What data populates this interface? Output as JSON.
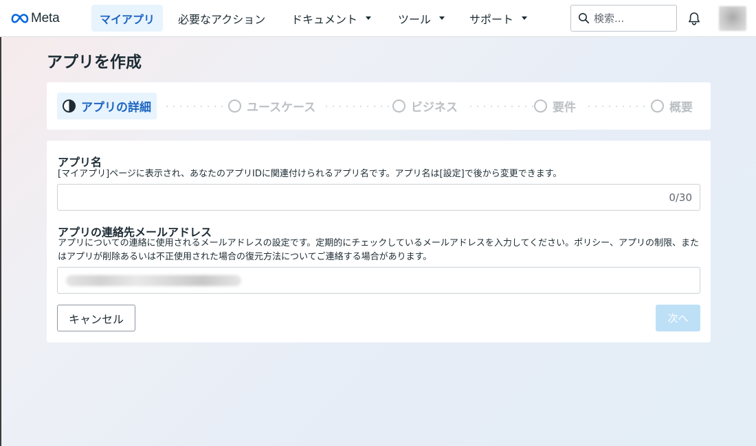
{
  "nav": {
    "logo_text": "Meta",
    "items": [
      {
        "label": "マイアプリ",
        "active": true
      },
      {
        "label": "必要なアクション"
      },
      {
        "label": "ドキュメント"
      },
      {
        "label": "ツール"
      },
      {
        "label": "サポート"
      }
    ],
    "search_placeholder": "検索...",
    "icons": {
      "search": "search-icon",
      "bell": "bell-icon",
      "dropdown": "caret-down-icon"
    }
  },
  "page": {
    "title": "アプリを作成"
  },
  "stepper": {
    "steps": [
      {
        "label": "アプリの詳細",
        "state": "current"
      },
      {
        "label": "ユースケース",
        "state": "todo"
      },
      {
        "label": "ビジネス",
        "state": "todo"
      },
      {
        "label": "要件",
        "state": "todo"
      },
      {
        "label": "概要",
        "state": "todo"
      }
    ]
  },
  "form": {
    "app_name": {
      "label": "アプリ名",
      "description": "[マイアプリ]ページに表示され、あなたのアプリIDに関連付けられるアプリ名です。アプリ名は[設定]で後から変更できます。",
      "value": "",
      "counter": "0/30"
    },
    "contact_email": {
      "label": "アプリの連絡先メールアドレス",
      "description": "アプリについての連絡に使用されるメールアドレスの設定です。定期的にチェックしているメールアドレスを入力してください。ポリシー、アプリの制限、またはアプリが削除あるいは不正使用された場合の復元方法についてご連絡する場合があります。"
    },
    "cancel_label": "キャンセル",
    "next_label": "次へ"
  },
  "colors": {
    "accent": "#1d65c1",
    "active_bg": "#e7f3fd",
    "disabled_button": "#bde0f7",
    "inactive_step": "#bcc0c4"
  }
}
